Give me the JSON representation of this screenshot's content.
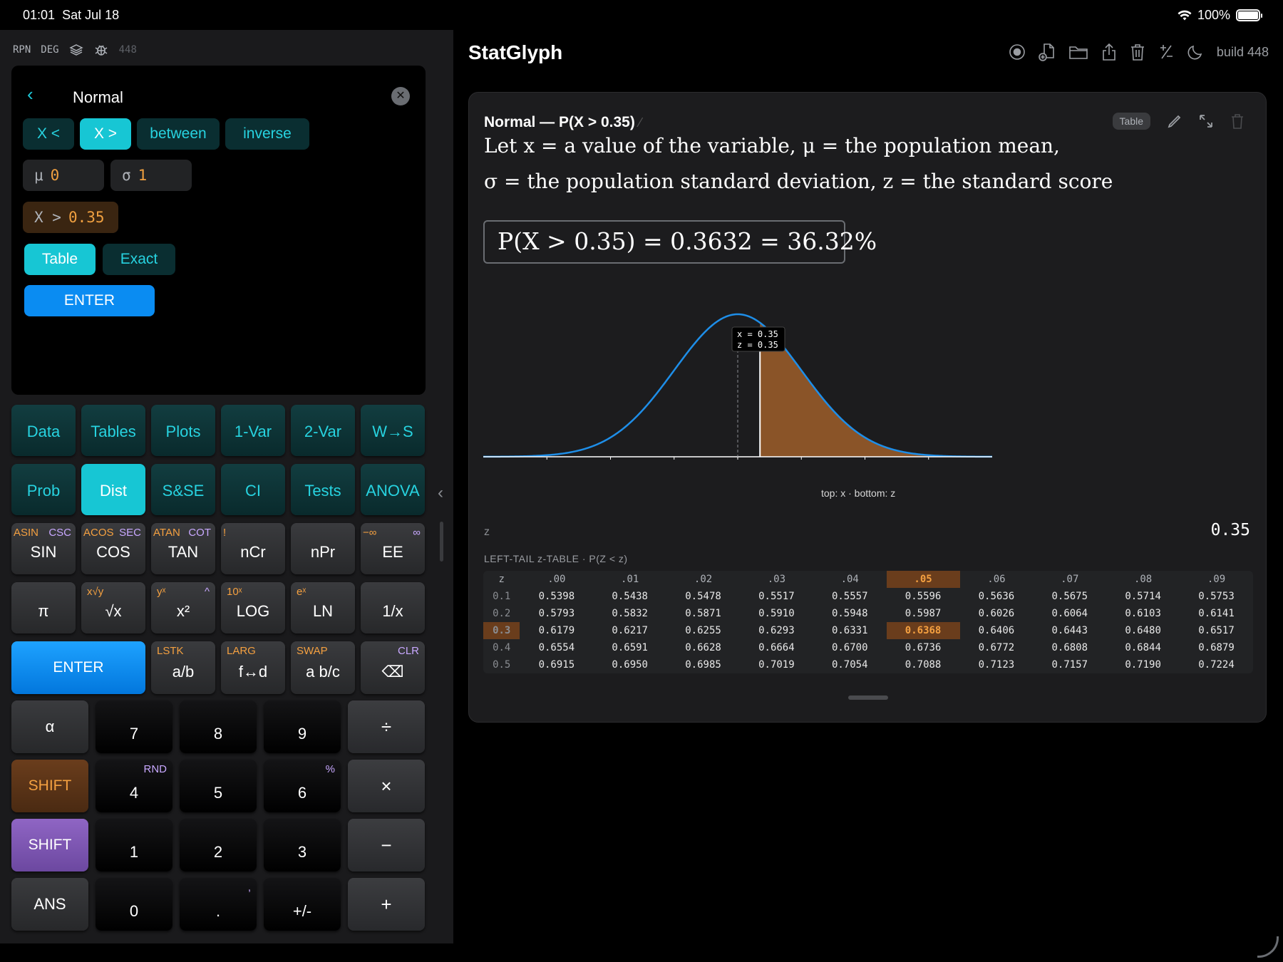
{
  "status": {
    "time": "01:01",
    "date": "Sat Jul 18",
    "battery": "100%"
  },
  "calc": {
    "modes": [
      "RPN",
      "DEG"
    ],
    "build": "448",
    "screen": {
      "title": "Normal",
      "tabs": [
        "X <",
        "X >",
        "between",
        "inverse"
      ],
      "mu_label": "μ",
      "mu_value": "0",
      "sigma_label": "σ",
      "sigma_value": "1",
      "cond_label": "X >",
      "cond_value": "0.35",
      "out_modes": [
        "Table",
        "Exact"
      ],
      "enter": "ENTER"
    },
    "menu_row1": [
      "Data",
      "Tables",
      "Plots",
      "1-Var",
      "2-Var",
      "W→S"
    ],
    "menu_row2": [
      "Prob",
      "Dist",
      "S&SE",
      "CI",
      "Tests",
      "ANOVA"
    ],
    "fn_row": [
      {
        "main": "SIN",
        "alt": "ASIN",
        "alt2": "CSC"
      },
      {
        "main": "COS",
        "alt": "ACOS",
        "alt2": "SEC"
      },
      {
        "main": "TAN",
        "alt": "ATAN",
        "alt2": "COT"
      },
      {
        "main": "nCr",
        "alt": "!",
        "alt2": ""
      },
      {
        "main": "nPr",
        "alt": "",
        "alt2": ""
      },
      {
        "main": "EE",
        "alt": "−∞",
        "alt2": "∞"
      }
    ],
    "sci_row": [
      {
        "main": "π",
        "alt": "",
        "alt2": ""
      },
      {
        "main": "√x",
        "alt": "x√y",
        "alt2": ""
      },
      {
        "main": "x²",
        "alt": "yˣ",
        "alt2": "^"
      },
      {
        "main": "LOG",
        "alt": "10ˣ",
        "alt2": ""
      },
      {
        "main": "LN",
        "alt": "eˣ",
        "alt2": ""
      },
      {
        "main": "1/x",
        "alt": "",
        "alt2": ""
      }
    ],
    "enter_key": "ENTER",
    "frac_row": [
      {
        "main": "a/b",
        "alt": "LSTK",
        "alt2": ""
      },
      {
        "main": "f↔d",
        "alt": "LARG",
        "alt2": ""
      },
      {
        "main": "a b/c",
        "alt": "SWAP",
        "alt2": ""
      },
      {
        "main": "⌫",
        "alt": "",
        "alt2": "CLR"
      }
    ],
    "left_col": [
      "α",
      "SHIFT",
      "SHIFT",
      "ANS"
    ],
    "digits": [
      [
        "7",
        "8",
        "9"
      ],
      [
        "4",
        "5",
        "6"
      ],
      [
        "1",
        "2",
        "3"
      ],
      [
        "0",
        ".",
        "+/-"
      ]
    ],
    "digit_alts": {
      "4": "RND",
      "6": "%",
      ".": ","
    },
    "ops": [
      "÷",
      "×",
      "−",
      "+"
    ]
  },
  "app": {
    "title": "StatGlyph",
    "build_label": "build 448"
  },
  "card": {
    "title": "Normal — P(X > 0.35)",
    "table_tag": "Table",
    "line1": "Let x = a value of the variable,  μ = the population mean,",
    "line2": "σ = the population standard deviation,  z = the standard score",
    "formula": "P(X > 0.35) = 0.3632 = 36.32%",
    "tooltip_x": "x = 0.35",
    "tooltip_z": "z = 0.35",
    "legend_note": "top: x  ·  bottom: z",
    "z_label": "z",
    "z_value": "0.35",
    "table_caption": "LEFT-TAIL z-TABLE · P(Z < z)"
  },
  "chart_data": {
    "type": "area",
    "mu": 0,
    "sigma": 1,
    "shade_from": 0.35,
    "xlim": [
      -4,
      4
    ],
    "x_ticks": [
      "-3",
      "-2",
      "-1",
      "0",
      "1",
      "2",
      "3"
    ],
    "z_ticks": [
      "-3",
      "-2",
      "-1",
      "0",
      "+1",
      "+2",
      "+3"
    ],
    "probability": 0.3632
  },
  "ztable": {
    "cols": [
      "z",
      ".00",
      ".01",
      ".02",
      ".03",
      ".04",
      ".05",
      ".06",
      ".07",
      ".08",
      ".09"
    ],
    "highlight_col": ".05",
    "highlight_row": "0.3",
    "rows": [
      [
        "0.1",
        "0.5398",
        "0.5438",
        "0.5478",
        "0.5517",
        "0.5557",
        "0.5596",
        "0.5636",
        "0.5675",
        "0.5714",
        "0.5753"
      ],
      [
        "0.2",
        "0.5793",
        "0.5832",
        "0.5871",
        "0.5910",
        "0.5948",
        "0.5987",
        "0.6026",
        "0.6064",
        "0.6103",
        "0.6141"
      ],
      [
        "0.3",
        "0.6179",
        "0.6217",
        "0.6255",
        "0.6293",
        "0.6331",
        "0.6368",
        "0.6406",
        "0.6443",
        "0.6480",
        "0.6517"
      ],
      [
        "0.4",
        "0.6554",
        "0.6591",
        "0.6628",
        "0.6664",
        "0.6700",
        "0.6736",
        "0.6772",
        "0.6808",
        "0.6844",
        "0.6879"
      ],
      [
        "0.5",
        "0.6915",
        "0.6950",
        "0.6985",
        "0.7019",
        "0.7054",
        "0.7088",
        "0.7123",
        "0.7157",
        "0.7190",
        "0.7224"
      ]
    ]
  },
  "colors": {
    "accent": "#17c6d4",
    "enter": "#0a8cf2",
    "curve": "#1e8ee8",
    "shade": "#8a5428",
    "highlight": "#f4a040"
  }
}
